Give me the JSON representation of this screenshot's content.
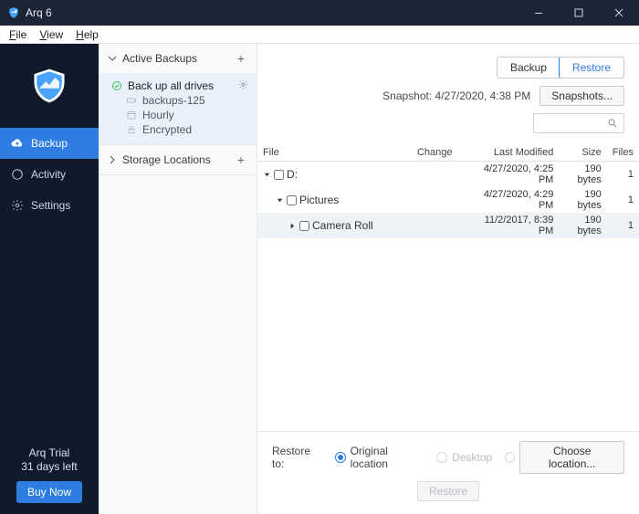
{
  "window": {
    "title": "Arq 6"
  },
  "menu": {
    "file": "File",
    "view": "View",
    "help": "Help"
  },
  "sidebar": {
    "items": [
      {
        "label": "Backup"
      },
      {
        "label": "Activity"
      },
      {
        "label": "Settings"
      }
    ],
    "trial_title": "Arq Trial",
    "trial_days": "31 days left",
    "buy": "Buy Now"
  },
  "mid": {
    "active_backups": "Active Backups",
    "storage_locations": "Storage Locations",
    "plan": {
      "name": "Back up all drives",
      "target": "backups-125",
      "schedule": "Hourly",
      "encryption": "Encrypted"
    }
  },
  "content": {
    "tabs": {
      "backup": "Backup",
      "restore": "Restore"
    },
    "snapshot_label": "Snapshot: 4/27/2020, 4:38 PM",
    "snapshots_btn": "Snapshots...",
    "columns": {
      "file": "File",
      "change": "Change",
      "modified": "Last Modified",
      "size": "Size",
      "files": "Files"
    },
    "rows": [
      {
        "name": "D:",
        "change": "",
        "modified": "4/27/2020, 4:25 PM",
        "size": "190 bytes",
        "files": "1",
        "level": 0,
        "expanded": true
      },
      {
        "name": "Pictures",
        "change": "",
        "modified": "4/27/2020, 4:29 PM",
        "size": "190 bytes",
        "files": "1",
        "level": 1,
        "expanded": true
      },
      {
        "name": "Camera Roll",
        "change": "",
        "modified": "11/2/2017, 8:39 PM",
        "size": "190 bytes",
        "files": "1",
        "level": 2,
        "expanded": false
      }
    ],
    "restore_to": "Restore to:",
    "opt_original": "Original location",
    "opt_desktop": "Desktop",
    "opt_choose": "Choose location...",
    "restore_btn": "Restore"
  }
}
